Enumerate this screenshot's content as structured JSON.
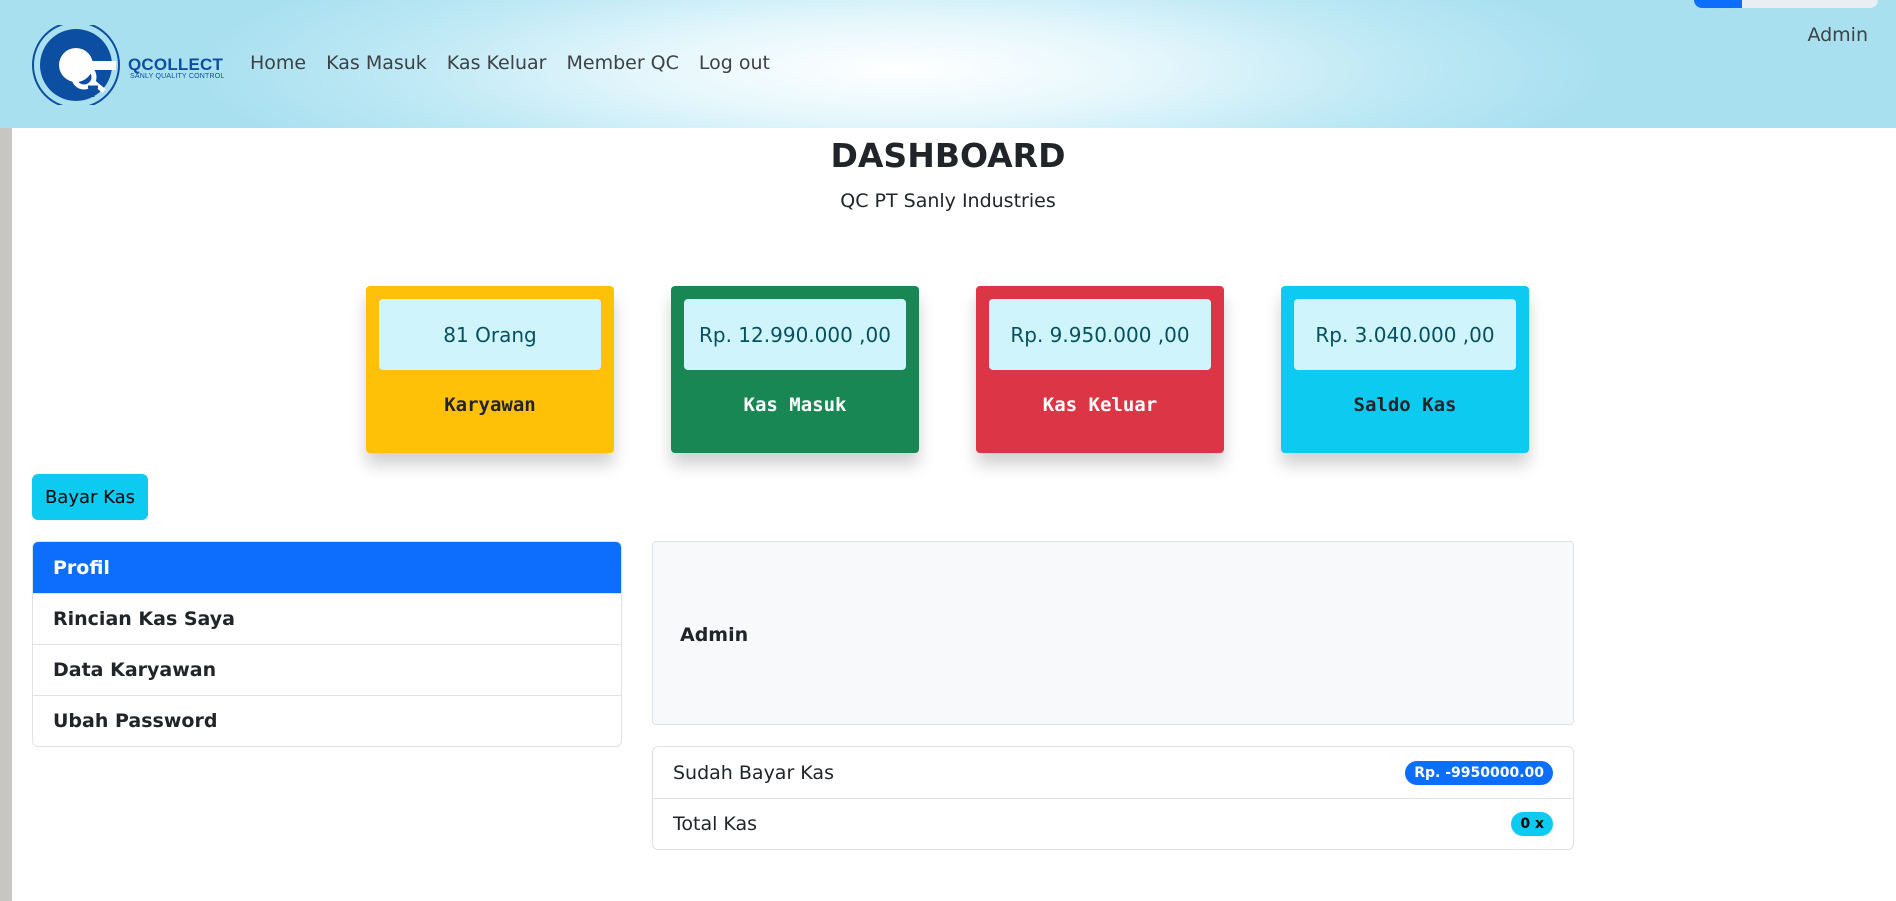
{
  "brand": {
    "name": "QCOLLECT",
    "tagline": "SANLY QUALITY CONTROL"
  },
  "nav": {
    "links": [
      "Home",
      "Kas Masuk",
      "Kas Keluar",
      "Member QC",
      "Log out"
    ],
    "user": "Admin"
  },
  "header": {
    "title": "DASHBOARD",
    "subtitle": "QC PT Sanly Industries"
  },
  "cards": [
    {
      "value": "81 Orang",
      "label": "Karyawan",
      "color": "#ffc107"
    },
    {
      "value": "Rp. 12.990.000 ,00",
      "label": "Kas Masuk",
      "color": "#198754"
    },
    {
      "value": "Rp. 9.950.000 ,00",
      "label": "Kas Keluar",
      "color": "#dc3545"
    },
    {
      "value": "Rp. 3.040.000 ,00",
      "label": "Saldo Kas",
      "color": "#0dcaf0"
    }
  ],
  "actions": {
    "bayar_kas": "Bayar Kas"
  },
  "menu": {
    "items": [
      "Profil",
      "Rincian Kas Saya",
      "Data Karyawan",
      "Ubah Password"
    ],
    "active": "Profil"
  },
  "profile": {
    "name": "Admin",
    "stats": [
      {
        "label": "Sudah Bayar Kas",
        "badge": "Rp. -9950000.00"
      },
      {
        "label": "Total Kas",
        "badge": "0 x"
      }
    ]
  },
  "colors": {
    "primary": "#0d6efd",
    "info": "#0dcaf0",
    "brand": "#0b4ea2"
  }
}
